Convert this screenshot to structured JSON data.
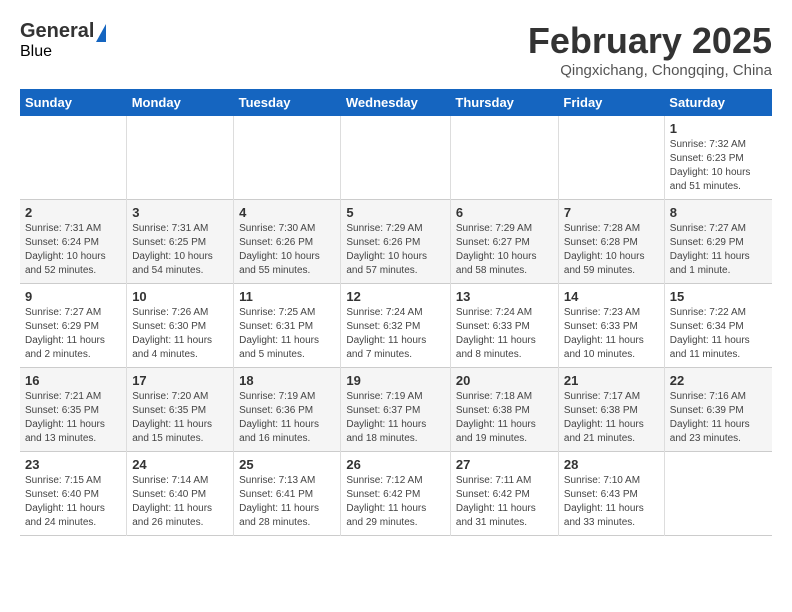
{
  "header": {
    "logo_general": "General",
    "logo_blue": "Blue",
    "title": "February 2025",
    "subtitle": "Qingxichang, Chongqing, China"
  },
  "days_of_week": [
    "Sunday",
    "Monday",
    "Tuesday",
    "Wednesday",
    "Thursday",
    "Friday",
    "Saturday"
  ],
  "weeks": [
    [
      {
        "day": "",
        "info": ""
      },
      {
        "day": "",
        "info": ""
      },
      {
        "day": "",
        "info": ""
      },
      {
        "day": "",
        "info": ""
      },
      {
        "day": "",
        "info": ""
      },
      {
        "day": "",
        "info": ""
      },
      {
        "day": "1",
        "info": "Sunrise: 7:32 AM\nSunset: 6:23 PM\nDaylight: 10 hours and 51 minutes."
      }
    ],
    [
      {
        "day": "2",
        "info": "Sunrise: 7:31 AM\nSunset: 6:24 PM\nDaylight: 10 hours and 52 minutes."
      },
      {
        "day": "3",
        "info": "Sunrise: 7:31 AM\nSunset: 6:25 PM\nDaylight: 10 hours and 54 minutes."
      },
      {
        "day": "4",
        "info": "Sunrise: 7:30 AM\nSunset: 6:26 PM\nDaylight: 10 hours and 55 minutes."
      },
      {
        "day": "5",
        "info": "Sunrise: 7:29 AM\nSunset: 6:26 PM\nDaylight: 10 hours and 57 minutes."
      },
      {
        "day": "6",
        "info": "Sunrise: 7:29 AM\nSunset: 6:27 PM\nDaylight: 10 hours and 58 minutes."
      },
      {
        "day": "7",
        "info": "Sunrise: 7:28 AM\nSunset: 6:28 PM\nDaylight: 10 hours and 59 minutes."
      },
      {
        "day": "8",
        "info": "Sunrise: 7:27 AM\nSunset: 6:29 PM\nDaylight: 11 hours and 1 minute."
      }
    ],
    [
      {
        "day": "9",
        "info": "Sunrise: 7:27 AM\nSunset: 6:29 PM\nDaylight: 11 hours and 2 minutes."
      },
      {
        "day": "10",
        "info": "Sunrise: 7:26 AM\nSunset: 6:30 PM\nDaylight: 11 hours and 4 minutes."
      },
      {
        "day": "11",
        "info": "Sunrise: 7:25 AM\nSunset: 6:31 PM\nDaylight: 11 hours and 5 minutes."
      },
      {
        "day": "12",
        "info": "Sunrise: 7:24 AM\nSunset: 6:32 PM\nDaylight: 11 hours and 7 minutes."
      },
      {
        "day": "13",
        "info": "Sunrise: 7:24 AM\nSunset: 6:33 PM\nDaylight: 11 hours and 8 minutes."
      },
      {
        "day": "14",
        "info": "Sunrise: 7:23 AM\nSunset: 6:33 PM\nDaylight: 11 hours and 10 minutes."
      },
      {
        "day": "15",
        "info": "Sunrise: 7:22 AM\nSunset: 6:34 PM\nDaylight: 11 hours and 11 minutes."
      }
    ],
    [
      {
        "day": "16",
        "info": "Sunrise: 7:21 AM\nSunset: 6:35 PM\nDaylight: 11 hours and 13 minutes."
      },
      {
        "day": "17",
        "info": "Sunrise: 7:20 AM\nSunset: 6:35 PM\nDaylight: 11 hours and 15 minutes."
      },
      {
        "day": "18",
        "info": "Sunrise: 7:19 AM\nSunset: 6:36 PM\nDaylight: 11 hours and 16 minutes."
      },
      {
        "day": "19",
        "info": "Sunrise: 7:19 AM\nSunset: 6:37 PM\nDaylight: 11 hours and 18 minutes."
      },
      {
        "day": "20",
        "info": "Sunrise: 7:18 AM\nSunset: 6:38 PM\nDaylight: 11 hours and 19 minutes."
      },
      {
        "day": "21",
        "info": "Sunrise: 7:17 AM\nSunset: 6:38 PM\nDaylight: 11 hours and 21 minutes."
      },
      {
        "day": "22",
        "info": "Sunrise: 7:16 AM\nSunset: 6:39 PM\nDaylight: 11 hours and 23 minutes."
      }
    ],
    [
      {
        "day": "23",
        "info": "Sunrise: 7:15 AM\nSunset: 6:40 PM\nDaylight: 11 hours and 24 minutes."
      },
      {
        "day": "24",
        "info": "Sunrise: 7:14 AM\nSunset: 6:40 PM\nDaylight: 11 hours and 26 minutes."
      },
      {
        "day": "25",
        "info": "Sunrise: 7:13 AM\nSunset: 6:41 PM\nDaylight: 11 hours and 28 minutes."
      },
      {
        "day": "26",
        "info": "Sunrise: 7:12 AM\nSunset: 6:42 PM\nDaylight: 11 hours and 29 minutes."
      },
      {
        "day": "27",
        "info": "Sunrise: 7:11 AM\nSunset: 6:42 PM\nDaylight: 11 hours and 31 minutes."
      },
      {
        "day": "28",
        "info": "Sunrise: 7:10 AM\nSunset: 6:43 PM\nDaylight: 11 hours and 33 minutes."
      },
      {
        "day": "",
        "info": ""
      }
    ]
  ]
}
